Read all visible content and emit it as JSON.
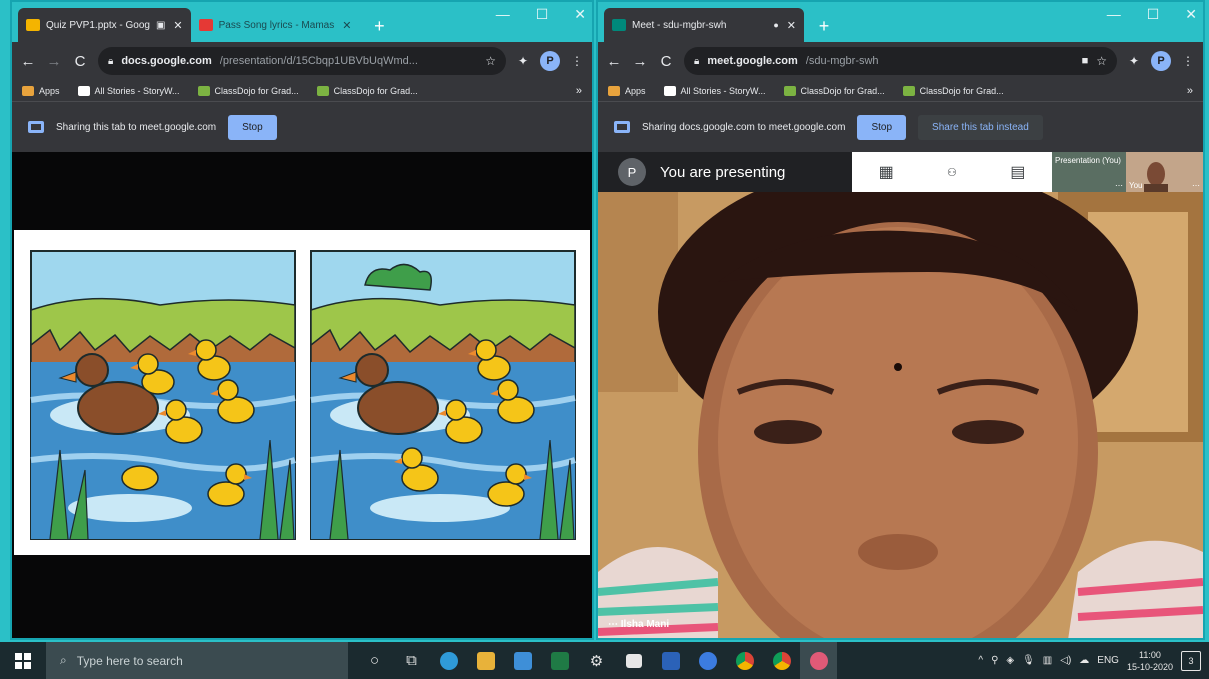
{
  "left_window": {
    "tabs": [
      {
        "title": "Quiz PVP1.pptx - Goog",
        "active": true,
        "favicon_color": "#f4b400"
      },
      {
        "title": "Pass Song lyrics - Mamas",
        "active": false,
        "favicon_color": "#e53935"
      }
    ],
    "url_host": "docs.google.com",
    "url_path": "/presentation/d/15Cbqp1UBVbUqWmd...",
    "bookmarks": [
      "Apps",
      "All Stories - StoryW...",
      "ClassDojo for Grad...",
      "ClassDojo for Grad..."
    ],
    "share_message": "Sharing this tab to meet.google.com",
    "stop_label": "Stop",
    "avatar_letter": "P"
  },
  "right_window": {
    "tabs": [
      {
        "title": "Meet - sdu-mgbr-swh",
        "active": true,
        "favicon_color": "#00897b"
      }
    ],
    "url_host": "meet.google.com",
    "url_path": "/sdu-mgbr-swh",
    "bookmarks": [
      "Apps",
      "All Stories - StoryW...",
      "ClassDojo for Grad...",
      "ClassDojo for Grad..."
    ],
    "share_message": "Sharing docs.google.com to meet.google.com",
    "stop_label": "Stop",
    "share_tab_label": "Share this tab instead",
    "avatar_letter": "P"
  },
  "meet": {
    "presenter_avatar": "P",
    "presenting_text": "You are presenting",
    "thumb_presentation_label": "Presentation (You)",
    "thumb_you_label": "You",
    "participant_name": "Ilsha Mani"
  },
  "taskbar": {
    "search_placeholder": "Type here to search",
    "language": "ENG",
    "time": "11:00",
    "date": "15-10-2020",
    "notification_count": "3"
  },
  "icons": {
    "windows": "windows-logo-icon",
    "search": "search-icon",
    "cortana": "cortana-icon",
    "taskview": "task-view-icon"
  }
}
